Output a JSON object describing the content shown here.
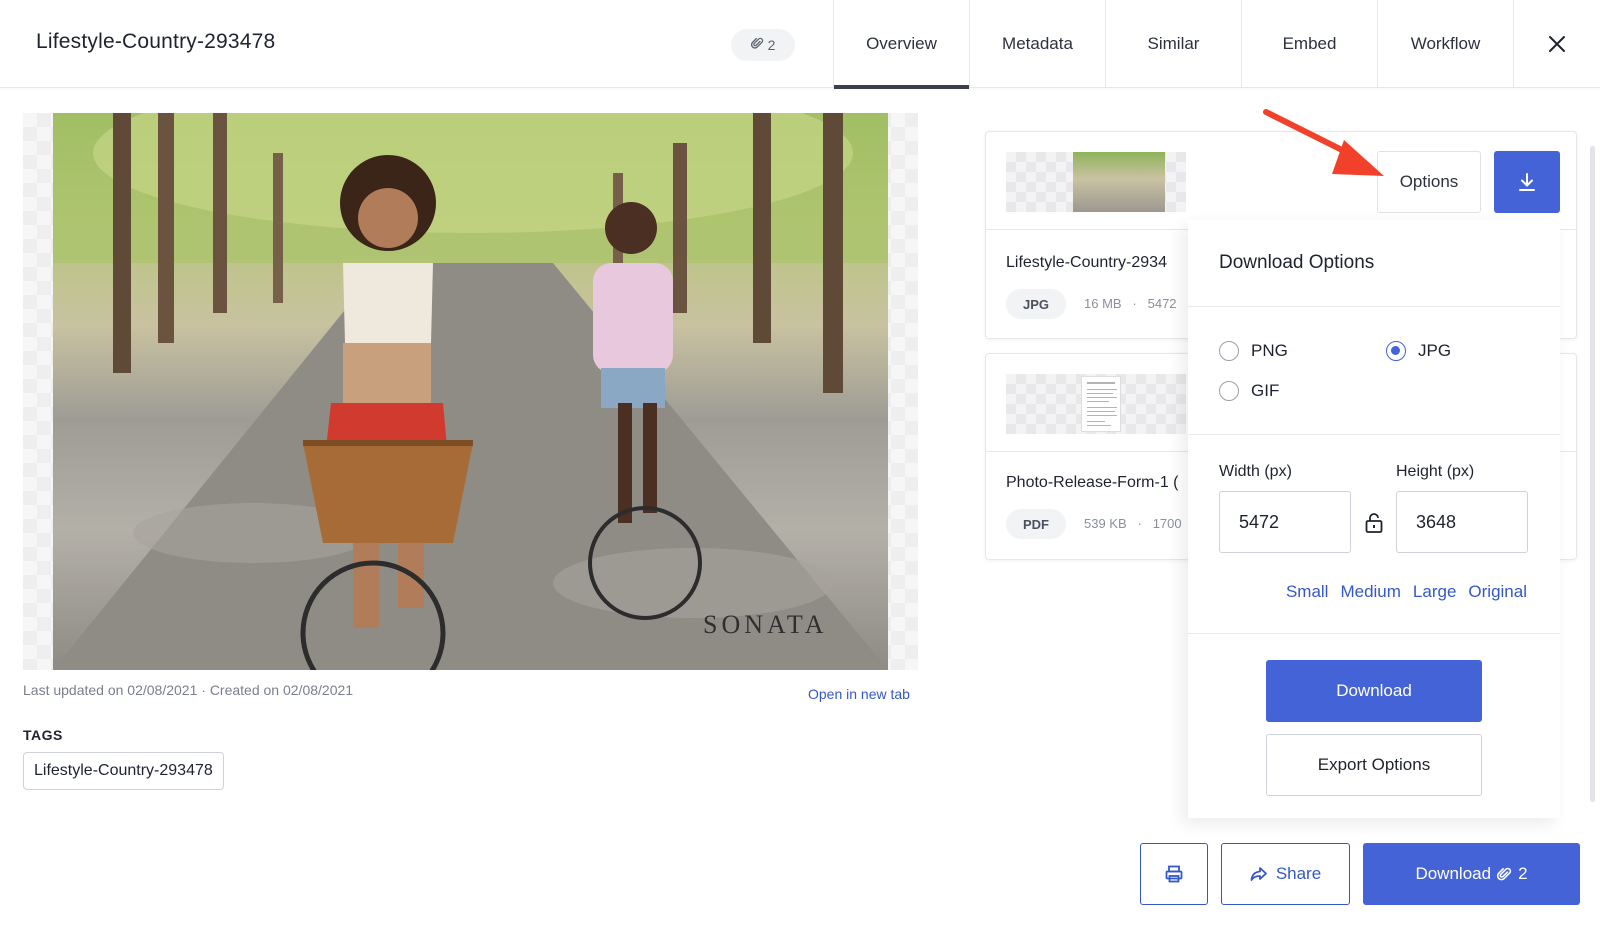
{
  "header": {
    "title": "Lifestyle-Country-293478",
    "attachment_count": "2",
    "tabs": [
      {
        "label": "Overview",
        "active": true
      },
      {
        "label": "Metadata",
        "active": false
      },
      {
        "label": "Similar",
        "active": false
      },
      {
        "label": "Embed",
        "active": false
      },
      {
        "label": "Workflow",
        "active": false
      }
    ],
    "close_icon": "close-icon"
  },
  "preview": {
    "watermark": "SONATA",
    "meta": "Last updated on 02/08/2021 · Created on 02/08/2021",
    "open_link": "Open in new tab",
    "tags_label": "TAGS",
    "tags": [
      "Lifestyle-Country-293478"
    ]
  },
  "assets": [
    {
      "name": "Lifestyle-Country-2934",
      "format": "JPG",
      "size": "16 MB",
      "dims": "5472"
    },
    {
      "name": "Photo-Release-Form-1 (",
      "format": "PDF",
      "size": "539 KB",
      "dims": "1700"
    }
  ],
  "controls": {
    "options_label": "Options",
    "download_icon": "download-icon"
  },
  "download_options": {
    "title": "Download Options",
    "formats": [
      {
        "label": "PNG",
        "selected": false
      },
      {
        "label": "JPG",
        "selected": true
      },
      {
        "label": "GIF",
        "selected": false
      }
    ],
    "width_label": "Width (px)",
    "height_label": "Height (px)",
    "width": "5472",
    "height": "3648",
    "sizes": [
      "Small",
      "Medium",
      "Large",
      "Original"
    ],
    "download_label": "Download",
    "export_label": "Export Options"
  },
  "footer": {
    "share_label": "Share",
    "download_label": "Download",
    "download_count": "2"
  },
  "colors": {
    "primary": "#4463d6",
    "link": "#3558c8",
    "annotation_arrow": "#f1412b"
  }
}
